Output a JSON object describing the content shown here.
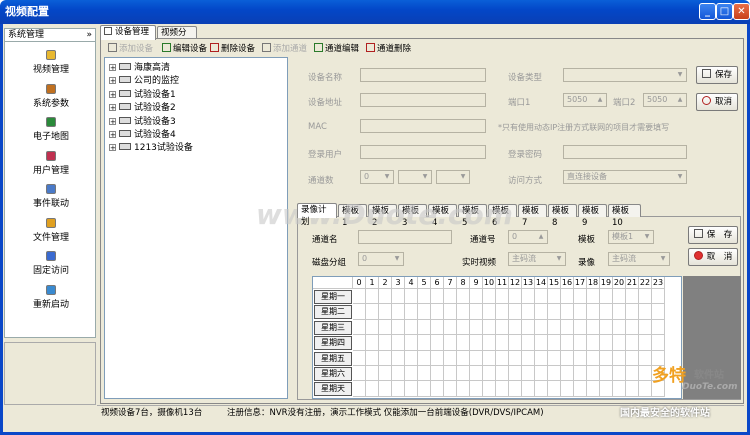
{
  "window": {
    "title": "视频配置",
    "min": "_",
    "max": "□",
    "close": "✕"
  },
  "left": {
    "header": "系统管理",
    "chevron": "»",
    "items": [
      {
        "label": "视频管理",
        "icon": "video-icon",
        "color": "#e8b830"
      },
      {
        "label": "系统参数",
        "icon": "settings-icon",
        "color": "#c07020"
      },
      {
        "label": "电子地图",
        "icon": "globe-icon",
        "color": "#2a8a3a"
      },
      {
        "label": "用户管理",
        "icon": "users-icon",
        "color": "#c03050"
      },
      {
        "label": "事件联动",
        "icon": "event-icon",
        "color": "#4a7ac8"
      },
      {
        "label": "文件管理",
        "icon": "folder-icon",
        "color": "#e0a020"
      },
      {
        "label": "固定访问",
        "icon": "access-icon",
        "color": "#3a6ad0"
      },
      {
        "label": "重新启动",
        "icon": "restart-icon",
        "color": "#3a8ad0"
      }
    ]
  },
  "tabs": {
    "top": [
      "设备管理",
      "视频分组"
    ]
  },
  "toolbar": {
    "add_device": "添加设备",
    "edit_device": "编辑设备",
    "delete_device": "删除设备",
    "add_channel": "添加通道",
    "edit_channel": "通道编辑",
    "delete_channel": "通道删除"
  },
  "tree": [
    "海康高清",
    "公司的监控",
    "试验设备1",
    "试验设备2",
    "试验设备3",
    "试验设备4",
    "1213试验设备"
  ],
  "form": {
    "device_name": "设备名称",
    "device_type": "设备类型",
    "device_address": "设备地址",
    "port1": "端口1",
    "port1_value": "5050",
    "port2": "端口2",
    "port2_value": "5050",
    "mac": "MAC",
    "mac_note": "*只有使用动态IP注册方式联网的项目才需要填写",
    "login_user": "登录用户",
    "login_password": "登录密码",
    "channel_count": "通道数",
    "channel_count_value": "0",
    "access_mode": "访问方式",
    "access_mode_value": "直连接设备",
    "save": "保存",
    "cancel": "取消"
  },
  "plan_tabs": [
    "录像计划",
    "模板1",
    "模板2",
    "模板3",
    "模板4",
    "模板5",
    "模板6",
    "模板7",
    "模板8",
    "模板9",
    "模板10"
  ],
  "plan": {
    "channel_name": "通道名",
    "channel_no": "通道号",
    "channel_no_value": "0",
    "template": "模板",
    "template_value": "模板1",
    "disk_group": "磁盘分组",
    "disk_group_value": "0",
    "live_video": "实时视频",
    "live_value": "主码流",
    "record": "录像",
    "record_value": "主码流",
    "save": "保　存",
    "cancel": "取　消"
  },
  "schedule": {
    "hours": [
      "0",
      "1",
      "2",
      "3",
      "4",
      "5",
      "6",
      "7",
      "8",
      "9",
      "10",
      "11",
      "12",
      "13",
      "14",
      "15",
      "16",
      "17",
      "18",
      "19",
      "20",
      "21",
      "22",
      "23"
    ],
    "days": [
      "星期一",
      "星期二",
      "星期三",
      "星期四",
      "星期五",
      "星期六",
      "星期天"
    ]
  },
  "status": {
    "devices": "视频设备7台，摄像机13台",
    "register": "注册信息：NVR没有注册，演示工作模式 仅能添加一台前端设备(DVR/DVS/IPCAM)"
  },
  "watermarks": {
    "center": "www.Duote.com",
    "logo": "多特",
    "logo_sub": "软件站",
    "corner": "DuoTe.com",
    "bottom": "国内最安全的软件站"
  }
}
